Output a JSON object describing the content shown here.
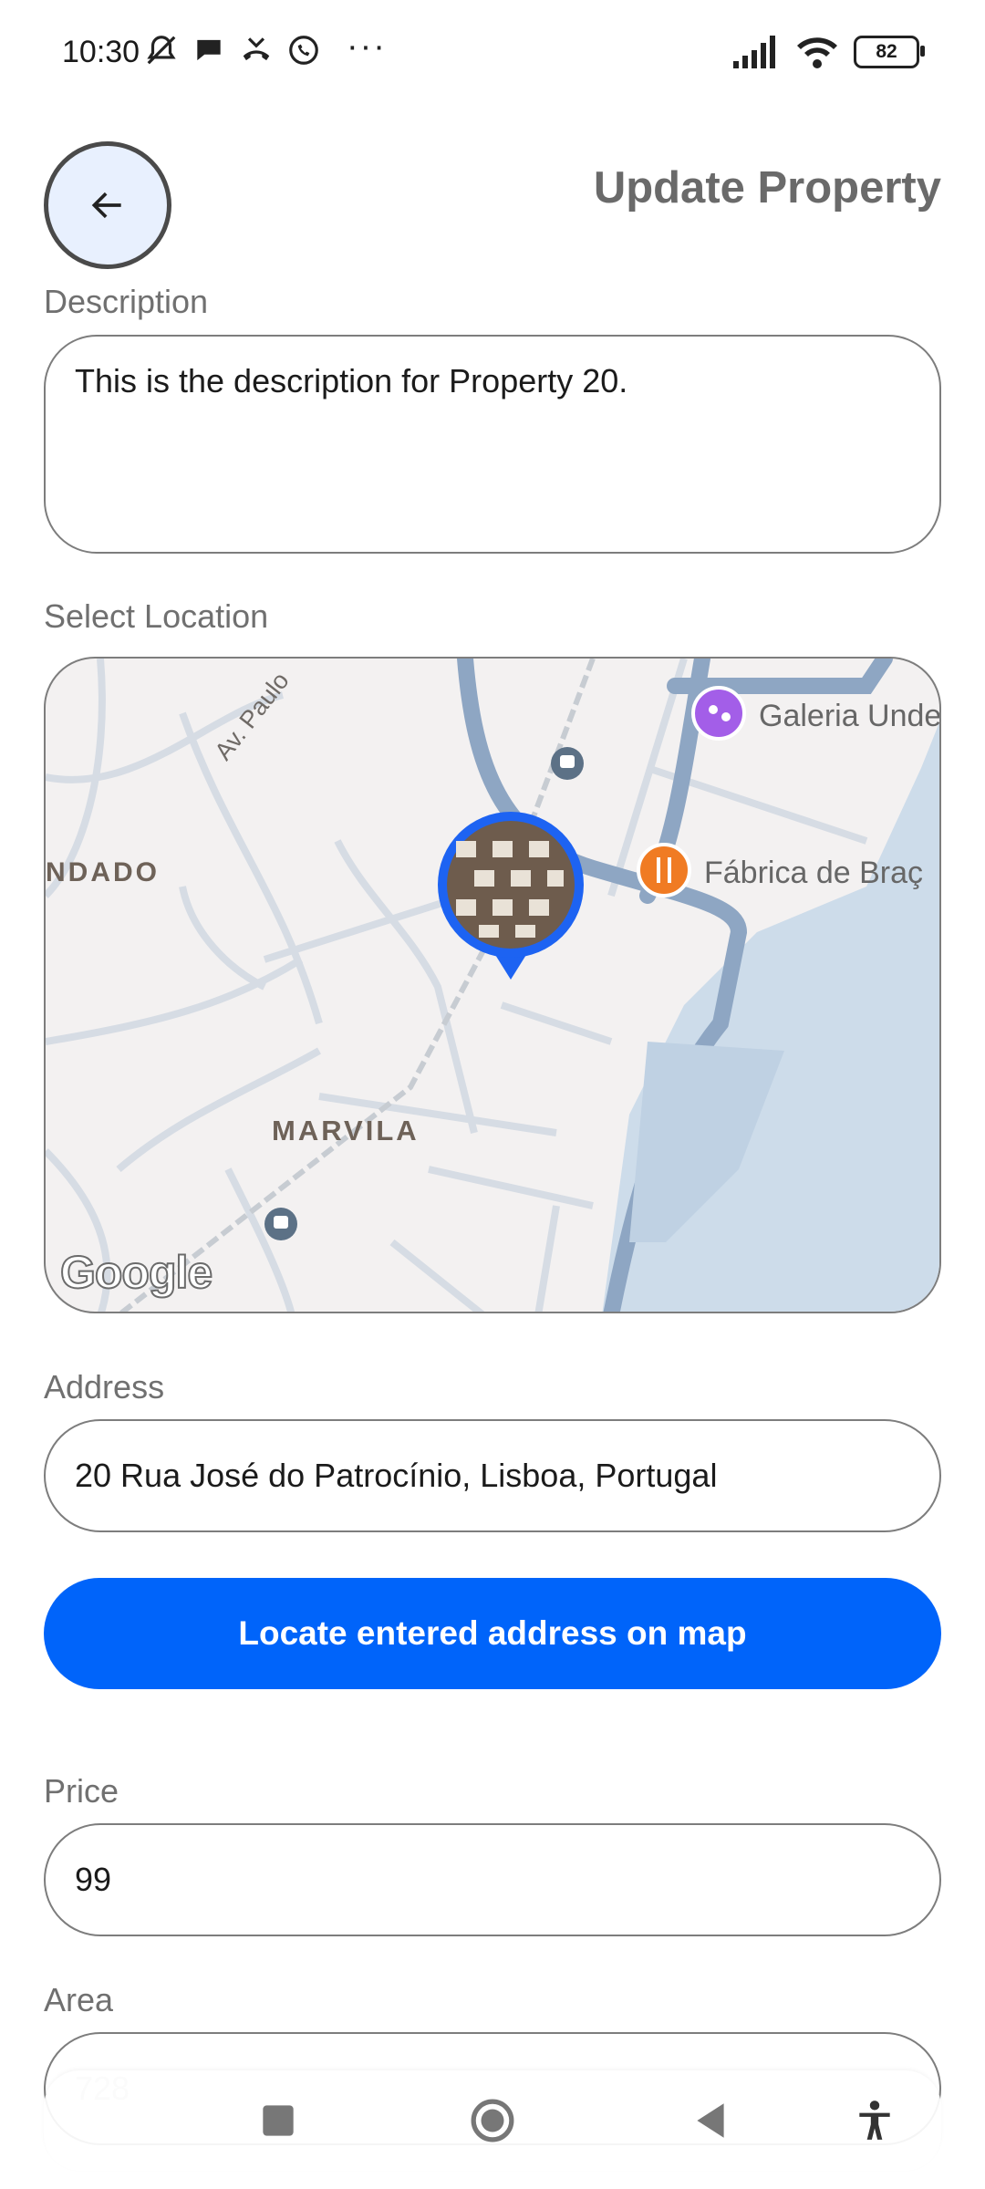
{
  "status_bar": {
    "time": "10:30",
    "more": "···",
    "battery": "82"
  },
  "header": {
    "title": "Update Property"
  },
  "description": {
    "label": "Description",
    "value": "This is the description for Property 20."
  },
  "location": {
    "label": "Select Location",
    "map_labels": {
      "av_paulo": "Av. Paulo",
      "district_left": "NDADO",
      "marvila": "MARVILA",
      "galeria": "Galeria Unde",
      "fabrica": "Fábrica de Braç",
      "google": "Google"
    }
  },
  "address": {
    "label": "Address",
    "value": "20 Rua José do Patrocínio, Lisboa, Portugal"
  },
  "locate_button": {
    "label": "Locate entered address on map"
  },
  "price": {
    "label": "Price",
    "value": "99"
  },
  "area": {
    "label": "Area",
    "placeholder": "728"
  },
  "colors": {
    "accent": "#0064fa",
    "map_road": "#8ea6c3",
    "water": "#cddcea"
  }
}
